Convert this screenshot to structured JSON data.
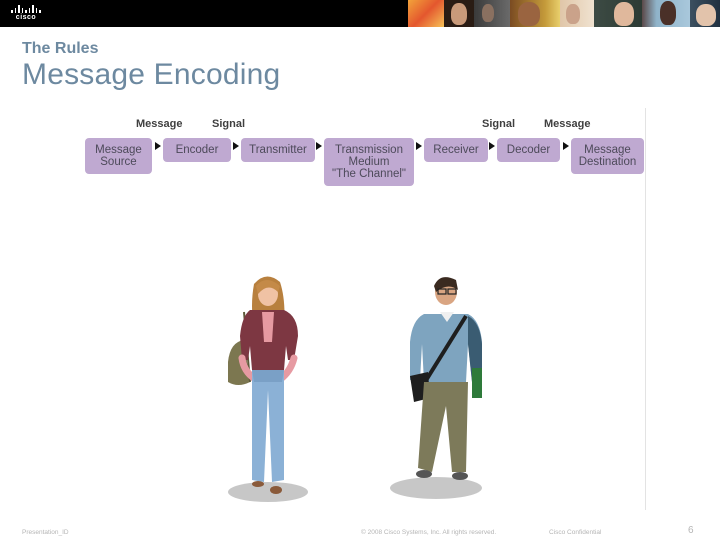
{
  "header": {
    "logo_text": "cisco",
    "photo_strip": [
      "photo-1",
      "photo-2",
      "photo-3",
      "photo-4",
      "photo-5",
      "photo-6",
      "photo-7"
    ]
  },
  "slide": {
    "subtitle": "The Rules",
    "title": "Message Encoding"
  },
  "diagram": {
    "top_labels": [
      "Message",
      "Signal",
      "Signal",
      "Message"
    ],
    "steps": [
      {
        "lines": [
          "Message",
          "Source"
        ]
      },
      {
        "lines": [
          "Encoder"
        ]
      },
      {
        "lines": [
          "Transmitter"
        ]
      },
      {
        "lines": [
          "Transmission",
          "Medium",
          "\"The Channel\""
        ]
      },
      {
        "lines": [
          "Receiver"
        ]
      },
      {
        "lines": [
          "Decoder"
        ]
      },
      {
        "lines": [
          "Message",
          "Destination"
        ]
      }
    ],
    "box_color": "#bfa9d1"
  },
  "illustrations": {
    "person_left": "woman-with-shoulder-bag",
    "person_right": "man-with-messenger-bag-and-book"
  },
  "footer": {
    "presentation_id": "Presentation_ID",
    "copyright": "© 2008 Cisco Systems, Inc. All rights reserved.",
    "confidential": "Cisco Confidential",
    "page_number": "6"
  },
  "colors": {
    "title": "#6d89a0",
    "banner": "#000000",
    "footer_text": "#b5b5b5"
  }
}
